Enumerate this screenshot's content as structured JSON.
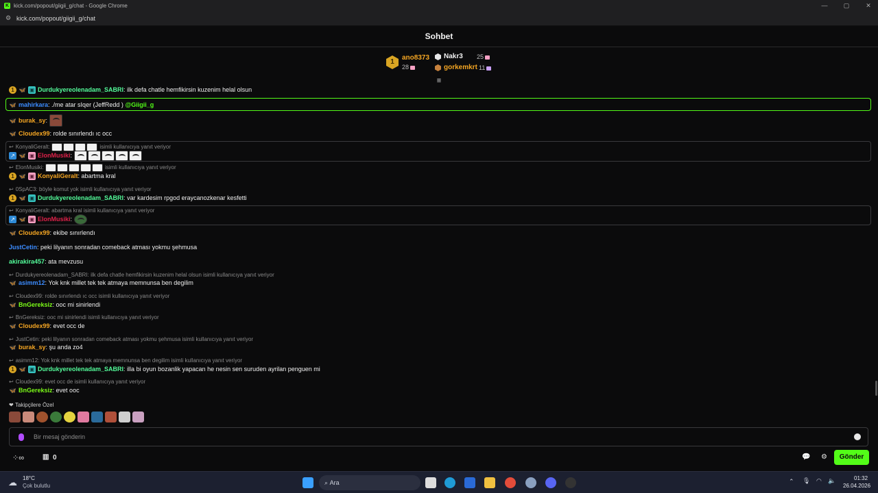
{
  "window": {
    "title": "kick.com/popout/giigii_g/chat - Google Chrome",
    "url": "kick.com/popout/giigii_g/chat"
  },
  "header": {
    "title": "Sohbet"
  },
  "leaderboard": {
    "first": {
      "rank": "1",
      "name": "ano8373",
      "count": "28"
    },
    "second": {
      "name": "Nakr3",
      "count": "25"
    },
    "third": {
      "name": "gorkemkrt",
      "count": "11"
    }
  },
  "messages": [
    {
      "user": "Durdukyereolenadam_SABRI",
      "text": "ilk defa chatle hemfikirsin kuzenim helal olsun",
      "color": "#53fc9a"
    },
    {
      "user": "mahirkara",
      "text": "./me atar sIqer (JeffRedd )",
      "mention": "@Giigii_g",
      "color": "#3c8cff"
    },
    {
      "user": "burak_sy",
      "text": "",
      "color": "#f5a623"
    },
    {
      "user": "Cloudex99",
      "text": "rolde sınırlendı ıc occ",
      "color": "#f5a623"
    },
    {
      "reply": "KonyaliGeralt:",
      "reply_suffix": "isimli kullanıcıya yanıt veriyor",
      "user": "ElonMusiki",
      "text": "",
      "color": "#e0224a"
    },
    {
      "reply": "ElonMusiki:",
      "reply_suffix": "isimli kullanıcıya yanıt veriyor",
      "user": "KonyaliGeralt",
      "text": "abartma kral",
      "color": "#f5a623"
    },
    {
      "reply": "0SpAC3: böyle komut yok isimli kullanıcıya yanıt veriyor",
      "user": "Durdukyereolenadam_SABRI",
      "text": "var kardesim rpgod eraycanozkenar kesfetti",
      "color": "#53fc9a"
    },
    {
      "reply": "KonyaliGeralt: abartma kral isimli kullanıcıya yanıt veriyor",
      "user": "ElonMusiki",
      "text": "",
      "color": "#e0224a"
    },
    {
      "user": "Cloudex99",
      "text": "ekibe sınırlendı",
      "color": "#f5a623"
    },
    {
      "user": "JustCetin",
      "text": "peki lilyanın sonradan comeback atması yokmu şehmusa",
      "color": "#3c8cff"
    },
    {
      "user": "akirakira457",
      "text": "ata mevzusu",
      "color": "#53fc9a"
    },
    {
      "reply": "Durdukyereolenadam_SABRI: ilk defa chatle hemfikirsin kuzenim helal olsun isimli kullanıcıya yanıt veriyor",
      "user": "asimm12",
      "text": "Yok knk millet tek tek atmaya memnunsa ben degilim",
      "color": "#3c8cff"
    },
    {
      "reply": "Cloudex99: rolde sınırlendı ıc occ isimli kullanıcıya yanıt veriyor",
      "user": "BnGereksiz",
      "text": "ooc mi sinirlendi",
      "color": "#7cfc18"
    },
    {
      "reply": "BnGereksiz: ooc mi sinirlendi isimli kullanıcıya yanıt veriyor",
      "user": "Cloudex99",
      "text": "evet occ de",
      "color": "#f5a623"
    },
    {
      "reply": "JustCetin: peki lilyanın sonradan comeback atması yokmu şehmusa isimli kullanıcıya yanıt veriyor",
      "user": "burak_sy",
      "text": "şu anda zo4",
      "color": "#f5a623"
    },
    {
      "reply": "asimm12: Yok knk millet tek tek atmaya memnunsa ben degilim isimli kullanıcıya yanıt veriyor",
      "user": "Durdukyereolenadam_SABRI",
      "text": "illa bi oyun bozanlik yapacan he nesin sen suruden ayrilan penguen mi",
      "color": "#53fc9a"
    },
    {
      "reply": "Cloudex99: evet occ de isimli kullanıcıya yanıt veriyor",
      "user": "BnGereksiz",
      "text": "evet ooc",
      "color": "#7cfc18"
    }
  ],
  "composer": {
    "followers_label": "Takipçilere Özel",
    "placeholder": "Bir mesaj gönderin",
    "send_label": "Gönder",
    "points": "0"
  },
  "taskbar": {
    "weather_temp": "18°C",
    "weather_desc": "Çok bulutlu",
    "search_placeholder": "Ara",
    "time": "01:32",
    "date": "26.04.2026"
  },
  "colors": {
    "accent": "#53fc18",
    "background": "#0b0b0c"
  }
}
